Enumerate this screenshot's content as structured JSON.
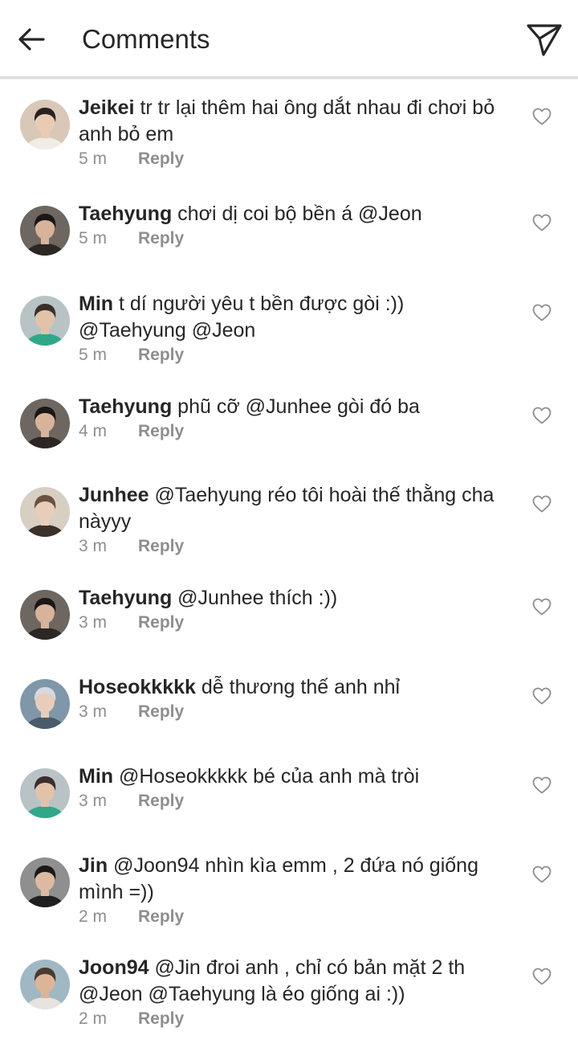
{
  "header": {
    "title": "Comments",
    "back_icon": "arrow-left-icon",
    "send_icon": "paper-plane-icon"
  },
  "colors": {
    "text": "#262626",
    "secondary": "#8e8e8e",
    "divider": "#dbdbdb"
  },
  "reply_label": "Reply",
  "comments": [
    {
      "username": "Jeikei",
      "text": "tr tr lại thêm hai ông dắt nhau đi chơi bỏ anh bỏ em",
      "time": "5 m",
      "avatar": "avatar-boy-dark-hair"
    },
    {
      "username": "Taehyung",
      "text": "chơi dị coi bộ bền á @Jeon",
      "time": "5 m",
      "avatar": "avatar-man-black-hair"
    },
    {
      "username": "Min",
      "text": "t dí người yêu t bền được gòi :)) @Taehyung @Jeon",
      "time": "5 m",
      "avatar": "avatar-green-shirt"
    },
    {
      "username": "Taehyung",
      "text": "phũ cỡ @Junhee gòi đó ba",
      "time": "4 m",
      "avatar": "avatar-man-black-hair"
    },
    {
      "username": "Junhee",
      "text": "@Taehyung réo tôi hoài thế thằng cha nàyyy",
      "time": "3 m",
      "avatar": "avatar-girl-dress"
    },
    {
      "username": "Taehyung",
      "text": "@Junhee thích :))",
      "time": "3 m",
      "avatar": "avatar-man-black-hair"
    },
    {
      "username": "Hoseokkkkk",
      "text": "dễ thương thế anh nhỉ",
      "time": "3 m",
      "avatar": "avatar-silver-hair"
    },
    {
      "username": "Min",
      "text": "@Hoseokkkkk bé của anh mà tròi",
      "time": "3 m",
      "avatar": "avatar-green-shirt"
    },
    {
      "username": "Jin",
      "text": "@Joon94 nhìn kìa emm , 2 đứa nó giống mình =))",
      "time": "2 m",
      "avatar": "avatar-man-suit"
    },
    {
      "username": "Joon94",
      "text": "@Jin đroi anh , chỉ có bản mặt 2 th @Jeon @Taehyung là éo giống ai :))",
      "time": "2 m",
      "avatar": "avatar-smiling-man"
    }
  ]
}
